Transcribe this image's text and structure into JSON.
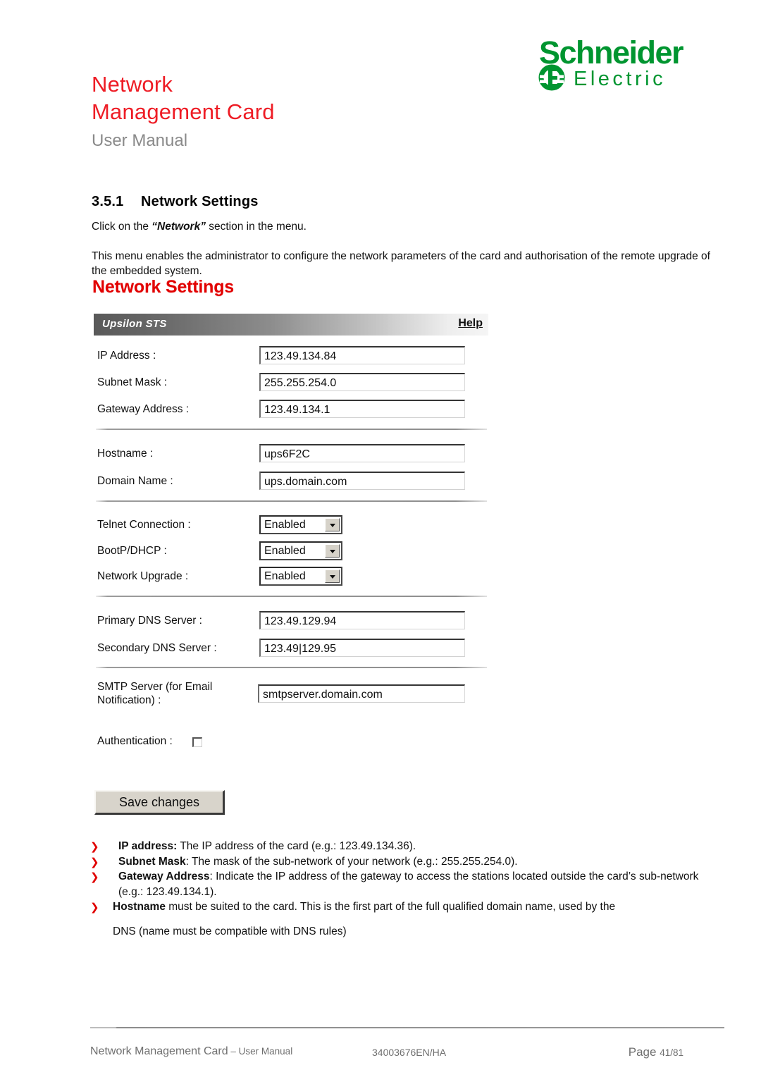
{
  "header": {
    "doc_title": "Network\nManagement Card",
    "doc_subtitle": "User Manual",
    "logo_name": "Schneider Electric",
    "logo_word_top": "Schneider",
    "logo_word_bottom": "Electric",
    "brand_green": "#009530",
    "title_red": "#ee1c25",
    "subtitle_gray": "#8a8a8a"
  },
  "section": {
    "number": "3.5.1",
    "heading": "Network Settings",
    "paragraph_1_prefix": "Click on the ",
    "paragraph_1_emphasis": "“Network”",
    "paragraph_1_suffix": " section in the menu.",
    "paragraph_2": "This menu enables the administrator to configure the network parameters of the card and authorisation of the remote upgrade of the embedded system."
  },
  "screenshot": {
    "title": "Network Settings",
    "title_color": "#e00000",
    "bar_label": "Upsilon STS",
    "help_label": "Help",
    "fields": [
      {
        "label": "IP Address :",
        "value": "123.49.134.84",
        "type": "text"
      },
      {
        "label": "Subnet Mask :",
        "value": "255.255.254.0",
        "type": "text"
      },
      {
        "label": "Gateway Address :",
        "value": "123.49.134.1",
        "type": "text"
      },
      {
        "label": "Hostname :",
        "value": "ups6F2C",
        "type": "text"
      },
      {
        "label": "Domain Name :",
        "value": "ups.domain.com",
        "type": "text"
      },
      {
        "label": "Telnet Connection :",
        "value": "Enabled",
        "type": "select"
      },
      {
        "label": "BootP/DHCP :",
        "value": "Enabled",
        "type": "select"
      },
      {
        "label": "Network Upgrade :",
        "value": "Enabled",
        "type": "select"
      },
      {
        "label": "Primary DNS Server :",
        "value": "123.49.129.94",
        "type": "text"
      },
      {
        "label": "Secondary DNS Server :",
        "value": "123.49|129.95",
        "type": "text"
      },
      {
        "label": "SMTP Server (for Email\nNotification) :",
        "value": "smtpserver.domain.com",
        "type": "text"
      },
      {
        "label": "Authentication :",
        "value": "",
        "type": "checkbox"
      }
    ],
    "save_button": "Save changes"
  },
  "bullets": [
    {
      "marker": "❯",
      "term": "IP address:",
      "text": " The IP address of the card (e.g.: 123.49.134.36)."
    },
    {
      "marker": "❯",
      "term": "Subnet Mask",
      "text": ": The mask of the sub-network of your network (e.g.: 255.255.254.0)."
    },
    {
      "marker": "❯",
      "term": "Gateway Address",
      "text": ": Indicate the IP address of the gateway to access the stations located outside the card’s sub-network (e.g.: 123.49.134.1)."
    },
    {
      "marker": "❯",
      "term": "Hostname",
      "text": " must be suited to the card. This is the first part of the full qualified domain name, used by the"
    }
  ],
  "bullet_tail": "DNS  (name must be compatible with DNS rules)",
  "footer": {
    "left_main": "Network Management Card",
    "left_dash": " – ",
    "left_small": "User Manual",
    "code": "34003676EN/HA",
    "page_word": "Page",
    "page_number": "41/81"
  }
}
